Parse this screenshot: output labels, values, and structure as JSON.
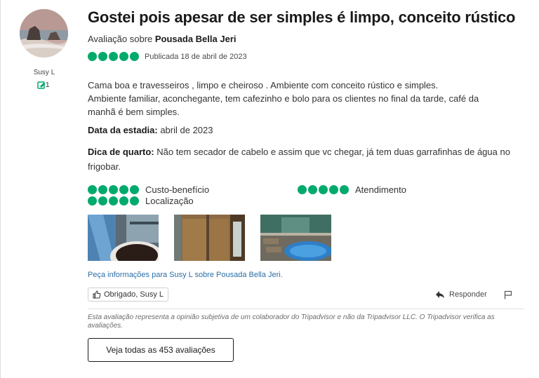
{
  "reviewer": {
    "name": "Susy L",
    "contributions": "1",
    "avatar_icon": "beach-avatar-image"
  },
  "review": {
    "title": "Gostei pois apesar de ser simples é limpo, conceito rústico",
    "about_prefix": "Avaliação sobre ",
    "property": "Pousada Bella Jeri",
    "rating": 5,
    "rating_max": 5,
    "published": "Publicada 18 de abril de 2023",
    "body": "Cama boa e travesseiros , limpo e cheiroso . Ambiente com conceito rústico e simples.\nAmbiente familiar, aconchegante, tem cafezinho e bolo para os clientes no final da tarde, café da manhã é bem simples.",
    "stay_label": "Data da estadia:",
    "stay_value": " abril de 2023",
    "tip_label": "Dica de quarto:",
    "tip_value": " Não tem secador de cabelo e assim que vc chegar, já tem duas garrafinhas de água no frigobar."
  },
  "sub_ratings": [
    {
      "label": "Custo-benefício",
      "rating": 5
    },
    {
      "label": "Atendimento",
      "rating": 5
    },
    {
      "label": "Localização",
      "rating": 5
    }
  ],
  "photos": [
    {
      "name": "coffee-cup-photo"
    },
    {
      "name": "wooden-room-photo"
    },
    {
      "name": "pool-photo"
    }
  ],
  "actions": {
    "ask_link": "Peça informações para Susy L sobre Pousada Bella Jeri.",
    "thanks_button": "Obrigado, Susy L",
    "reply_button": "Responder",
    "flag_icon": "flag-icon"
  },
  "disclaimer": "Esta avaliação representa a opinião subjetiva de um colaborador do Tripadvisor e não da Tripadvisor LLC. O Tripadvisor verifica as avaliações.",
  "all_reviews_button": "Veja todas as 453 avaliações",
  "colors": {
    "bubble": "#00aa6c",
    "link": "#2b6ea6"
  }
}
